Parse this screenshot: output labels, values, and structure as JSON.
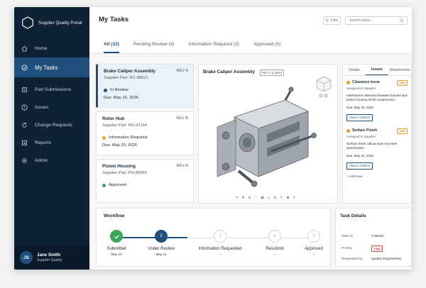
{
  "brand": {
    "title": "Supplier Quality Portal"
  },
  "nav": [
    {
      "label": "Home",
      "icon": "home-icon",
      "active": false
    },
    {
      "label": "My Tasks",
      "icon": "check-circle-icon",
      "active": true
    },
    {
      "label": "Part Submissions",
      "icon": "folder-icon",
      "active": false
    },
    {
      "label": "Issues",
      "icon": "alert-circle-icon",
      "active": false
    },
    {
      "label": "Change Requests",
      "icon": "refresh-icon",
      "active": false
    },
    {
      "label": "Reports",
      "icon": "report-icon",
      "active": false
    },
    {
      "label": "Admin",
      "icon": "gear-icon",
      "active": false
    }
  ],
  "user": {
    "initials": "JS",
    "name": "Jane Smith",
    "role": "Supplier Quality"
  },
  "header": {
    "title": "My Tasks",
    "filter_label": "Filter",
    "search_placeholder": "Search tasks..."
  },
  "tabs": [
    {
      "label": "All (12)",
      "active": true
    },
    {
      "label": "Pending Review (4)",
      "active": false
    },
    {
      "label": "Information Required (3)",
      "active": false
    },
    {
      "label": "Approved (5)",
      "active": false
    }
  ],
  "tasks": [
    {
      "name": "Brake Caliper Assembly",
      "rev": "REV A",
      "part": "Supplier Part: BC-88921",
      "status": "In Review",
      "status_color": "#1f4f7a",
      "due": "Due: May 16, 2026",
      "selected": true
    },
    {
      "name": "Rotor Hub",
      "rev": "REV B",
      "part": "Supplier Part: RH-23144",
      "status": "Information Required",
      "status_color": "#e8a126",
      "due": "Due: May 20, 2026",
      "selected": false
    },
    {
      "name": "Piston Housing",
      "rev": "REV A",
      "part": "Supplier Part: PH-88455",
      "status": "Approved",
      "status_color": "#3aa757",
      "due": "",
      "selected": false
    }
  ],
  "viewer": {
    "title": "Brake Caliper Assembly",
    "badge": "REV A (Latest)"
  },
  "issues_panel": {
    "tabs": [
      {
        "label": "Details",
        "active": false
      },
      {
        "label": "Issues",
        "active": true
      },
      {
        "label": "Attachments",
        "active": false
      }
    ],
    "issues": [
      {
        "title": "Clearance Issue",
        "badge": "Open",
        "assigned": "Assigned to Supplier",
        "description": "Interference detected between bracket and piston housing at full compression.",
        "due": "Due: May 16, 2026",
        "button": "View in Context"
      },
      {
        "title": "Surface Finish",
        "badge": "Open",
        "assigned": "Assigned to Supplier",
        "description": "Surface finish callout does not meet specification",
        "due": "Due: May 16, 2026",
        "button": "View in Context"
      }
    ],
    "add_label": "+ Add Issue"
  },
  "workflow": {
    "title": "Workflow",
    "steps": [
      {
        "label": "Submitted",
        "date": "May 10",
        "marker": "",
        "state": "done"
      },
      {
        "label": "Under Review",
        "date": "May 12",
        "marker": "2",
        "state": "current"
      },
      {
        "label": "Information Requested",
        "date": "–",
        "marker": "3",
        "state": "todo"
      },
      {
        "label": "Resubmit",
        "date": "–",
        "marker": "4",
        "state": "todo"
      },
      {
        "label": "Approved",
        "date": "–",
        "marker": "5",
        "state": "todo"
      }
    ]
  },
  "task_details": {
    "title": "Task Details",
    "rows": [
      {
        "label": "Task ID",
        "value": "T-88421"
      },
      {
        "label": "Priority",
        "value": "High"
      },
      {
        "label": "Requested by",
        "value": "Quality Engineering"
      }
    ]
  }
}
